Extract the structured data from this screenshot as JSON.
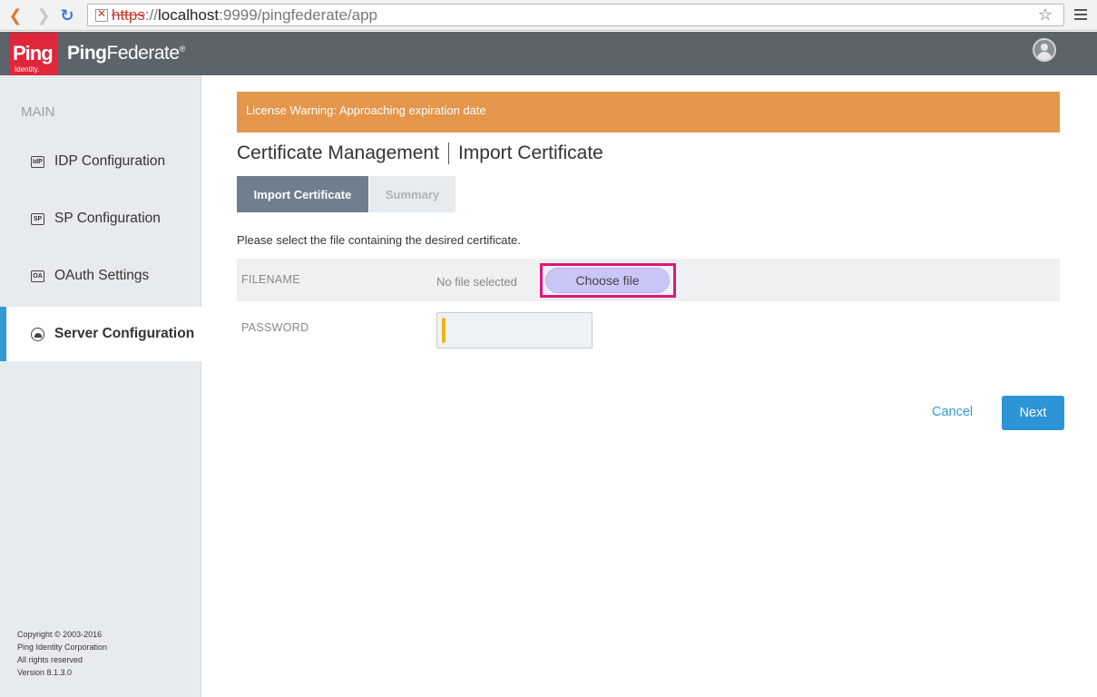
{
  "browser": {
    "url_scheme": "https",
    "url_sep": "://",
    "url_host": "localhost",
    "url_rest": ":9999/pingfederate/app"
  },
  "header": {
    "logo_big": "Ping",
    "logo_small": "Identity.",
    "product_name_a": "Ping",
    "product_name_b": "Federate",
    "product_mark": "®"
  },
  "sidebar": {
    "title": "MAIN",
    "items": [
      {
        "icon_text": "IdP",
        "label": "IDP Configuration"
      },
      {
        "icon_text": "SP",
        "label": "SP Configuration"
      },
      {
        "icon_text": "OA",
        "label": "OAuth Settings"
      },
      {
        "icon_text": "",
        "label": "Server Configuration"
      }
    ],
    "footer": {
      "line1": "Copyright © 2003-2016",
      "line2": "Ping Identity Corporation",
      "line3": "All rights reserved",
      "line4": "Version 8.1.3.0"
    }
  },
  "main": {
    "warning": "License Warning: Approaching expiration date",
    "heading_a": "Certificate Management",
    "heading_b": "Import Certificate",
    "tabs": [
      {
        "label": "Import Certificate"
      },
      {
        "label": "Summary"
      }
    ],
    "instructions": "Please select the file containing the desired certificate.",
    "filename_label": "FILENAME",
    "no_file": "No file selected",
    "choose_file": "Choose file",
    "password_label": "PASSWORD",
    "cancel": "Cancel",
    "next": "Next"
  },
  "colors": {
    "header_bg": "#5b646b",
    "brand_red": "#e0263a",
    "accent_blue": "#3299d3",
    "warning_orange": "#e3964c",
    "highlight_magenta": "#e0167a"
  }
}
